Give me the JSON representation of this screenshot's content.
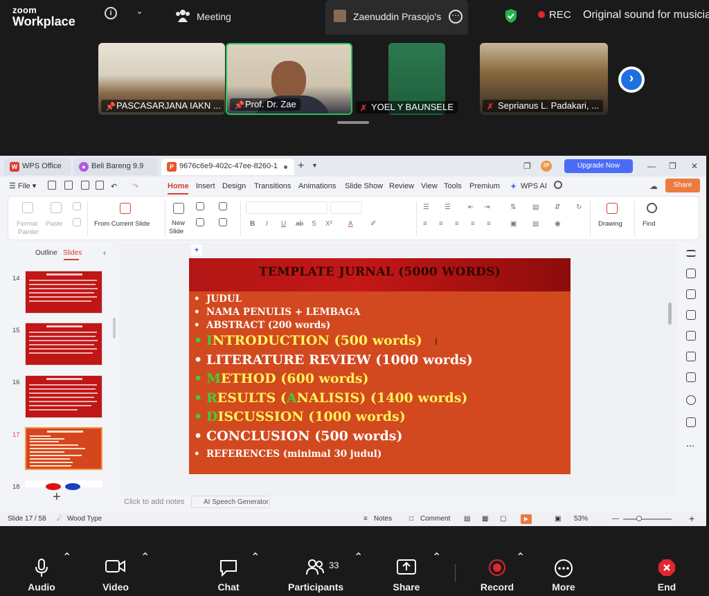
{
  "zoom": {
    "brand_small": "zoom",
    "brand_big": "Workplace",
    "meeting_label": "Meeting",
    "share_tab_text": "Zaenuddin Prasojo's s",
    "rec_label": "REC",
    "sound_label": "Original sound for musicians",
    "participants": [
      {
        "name": "PASCASARJANA IAKN ...",
        "status": "pinned"
      },
      {
        "name": "Prof. Dr. Zae",
        "status": "pinned-speaking"
      },
      {
        "name": "YOEL Y BAUNSELE",
        "status": "muted"
      },
      {
        "name": "Seprianus L. Padakari, ...",
        "status": "muted"
      }
    ],
    "bottom": {
      "audio": "Audio",
      "video": "Video",
      "chat": "Chat",
      "participants": "Participants",
      "participants_count": "33",
      "share": "Share",
      "record": "Record",
      "more": "More",
      "end": "End"
    },
    "colors": {
      "speaking_border": "#25c45a",
      "rec": "#e0262f",
      "next": "#1e6fe0"
    }
  },
  "wps": {
    "tabs": [
      "WPS Office",
      "Beli Bareng 9.9",
      "9676c6e9-402c-47ee-8260-1"
    ],
    "zp_badge": "ZP",
    "upgrade": "Upgrade Now",
    "share": "Share",
    "menu_file": "File",
    "menu_tabs": [
      "Home",
      "Insert",
      "Design",
      "Transitions",
      "Animations",
      "Slide Show",
      "Review",
      "View",
      "Tools",
      "Premium"
    ],
    "wps_ai": "WPS AI",
    "ribbon": {
      "format_painter": "Format\nPainter",
      "format_line1": "Format",
      "format_line2": "Painter",
      "paste": "Paste",
      "from_current_slide": "From Current Slide",
      "new_slide_line1": "New",
      "new_slide_line2": "Slide",
      "drawing": "Drawing",
      "find": "Find"
    },
    "left_pane": {
      "outline": "Outline",
      "slides": "Slides",
      "thumb_numbers": [
        "14",
        "15",
        "16",
        "17",
        "18"
      ]
    },
    "slide": {
      "title": "TEMPLATE JURNAL (5000 WORDS)",
      "items": [
        {
          "lead": "",
          "text": "JUDUL"
        },
        {
          "lead": "",
          "text": "NAMA PENULIS + LEMBAGA"
        },
        {
          "lead": "",
          "text": "ABSTRACT (200 words)"
        },
        {
          "lead": "I",
          "text": "NTRODUCTION (500 words)"
        },
        {
          "lead": "",
          "text": "LITERATURE REVIEW (1000 words)"
        },
        {
          "lead": "M",
          "text": "ETHOD (600 words)"
        },
        {
          "lead": "R",
          "text": "ESULTS (",
          "lead2": "A",
          "text2": "NALISIS) (1400 words)"
        },
        {
          "lead": "D",
          "text": "ISCUSSION (1000 words)"
        },
        {
          "lead": "",
          "text": "CONCLUSION (500 words)"
        },
        {
          "lead": "",
          "text": "REFERENCES (minimal 30 judul)"
        }
      ],
      "colors": {
        "background": "#d3491f",
        "header": "#b21616",
        "highlight": "#fff35b",
        "initial": "#3ecf34"
      }
    },
    "notes_placeholder": "Click to add notes",
    "ai_speech": "AI Speech Generator",
    "status": {
      "slide": "Slide 17 / 58",
      "theme": "Wood Type",
      "notes": "Notes",
      "comment": "Comment",
      "zoom": "53%"
    }
  }
}
